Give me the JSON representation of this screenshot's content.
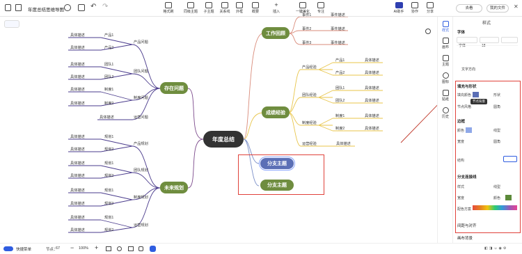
{
  "app": {
    "doc_title": "年度总结思维导图"
  },
  "toolbar": {
    "buttons": [
      "格式刷",
      "同级主题",
      "子主题",
      "关系线",
      "外框",
      "概要",
      "插入",
      "一键美化",
      "专注"
    ],
    "ai_label": "AI助手",
    "collab_label": "协作",
    "share_label": "分享",
    "save_cloud": "去看",
    "my_files": "我的文件"
  },
  "sidebar": {
    "items": [
      "样式",
      "画布",
      "主题",
      "图标",
      "贴纸",
      "历史"
    ]
  },
  "panel": {
    "title": "样式",
    "section_font": "字体",
    "font_family": "字体",
    "font_size": "18",
    "text_direction": "文字方向",
    "section_fill": "填充与形状",
    "fill_color_label": "填充颜色",
    "shape_label": "形状",
    "node_style_label": "节点风格",
    "round_label": "圆角",
    "tooltip": "节点背景",
    "section_border": "边框",
    "color_label": "颜色",
    "line_label": "线型",
    "width_label": "宽度",
    "corner_label": "圆角",
    "section_structure": "结构",
    "section_branch": "分支连接线",
    "style_label": "样式",
    "branch_line_label": "线型",
    "branch_width_label": "宽度",
    "branch_color_label": "颜色",
    "palette_label": "配色方案",
    "section_spacing": "间距与对齐",
    "section_bg": "画布背景",
    "colors": {
      "fill": "#5b6fb6",
      "border": "#8fa8e8",
      "branch": "#5c8a3a"
    }
  },
  "mindmap": {
    "center": "年度总结",
    "branches": {
      "problems": "存在问题",
      "plan": "未来规划",
      "review": "工作回顾",
      "achieve": "成绩经验",
      "sub1": "分支主题",
      "sub2": "分支主题"
    },
    "problems_children": [
      "产品问题",
      "团队问题",
      "制度问题",
      "运营问题"
    ],
    "problems_items": [
      "产品1",
      "产品2",
      "团队1",
      "团队2",
      "制度1",
      "制度2"
    ],
    "plan_children": [
      "产品规划",
      "团队规划",
      "制度规划",
      "运营规划"
    ],
    "plan_items": [
      "规划1",
      "规划2",
      "规划1",
      "规划2",
      "规划1",
      "规划2",
      "规划1",
      "规划2"
    ],
    "desc": "具体描述",
    "review_items": [
      "事件1",
      "事件2",
      "事件3"
    ],
    "review_desc": "事件描述",
    "achieve_children": [
      "产品经验",
      "团队经验",
      "制度经验",
      "运营经验"
    ],
    "achieve_items": [
      "产品1",
      "产品2",
      "团队1",
      "团队2",
      "制度1",
      "制度2"
    ]
  },
  "status": {
    "mode": "快捷菜单",
    "nodes_label": "节点：",
    "nodes": "67",
    "zoom": "100%"
  }
}
